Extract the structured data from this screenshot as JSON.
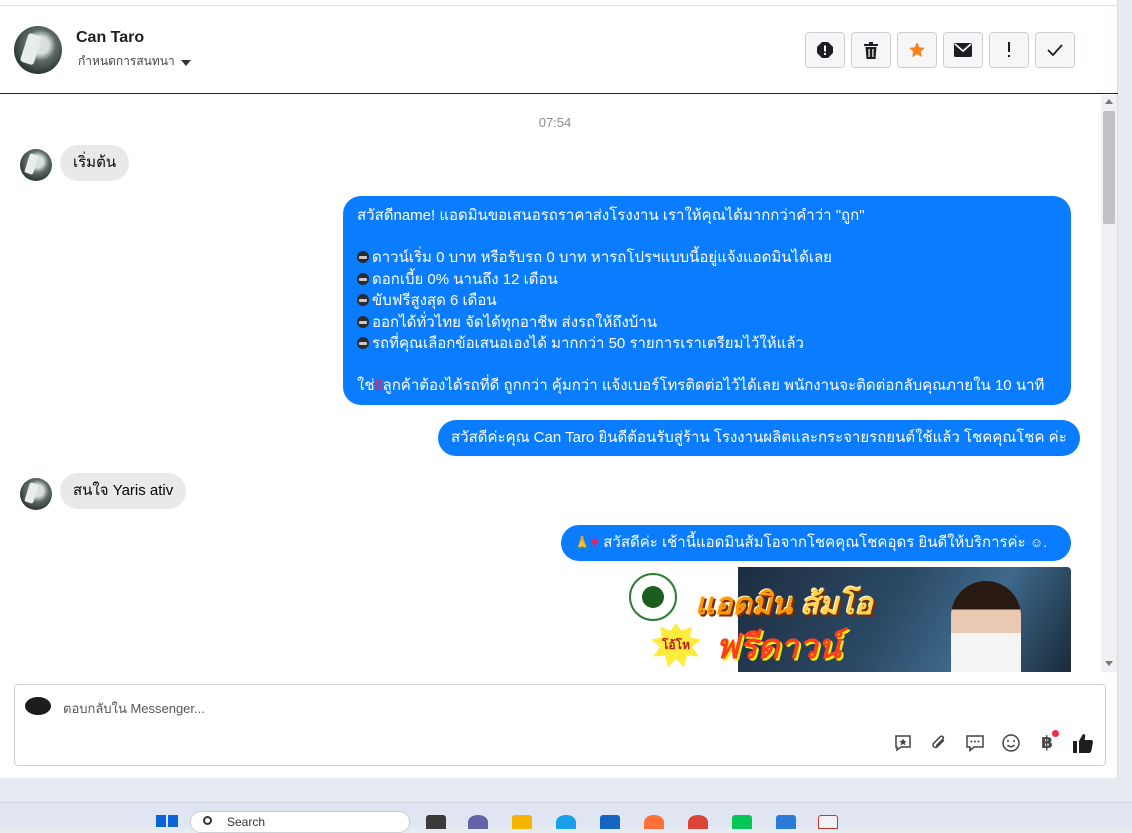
{
  "header": {
    "contact_name": "Can Taro",
    "assign_label": "กำหนดการสนทนา",
    "actions": [
      "spam-icon",
      "trash-icon",
      "star-icon",
      "envelope-icon",
      "exclamation-icon",
      "check-icon"
    ],
    "star_color": "#f5821f"
  },
  "chat": {
    "timestamp": "07:54",
    "messages": [
      {
        "dir": "in",
        "text": "เริ่มต้น"
      },
      {
        "dir": "out",
        "lines": [
          "สวัสดีname! แอดมินขอเสนอรถราคาส่งโรงงาน เราให้คุณได้มากกว่าคำว่า \"ถูก\"",
          "",
          "ดาวน์เริ่ม 0 บาท หรือรับรถ 0 บาท หารถโปรฯแบบนี้อยู่แจ้งแอดมินได้เลย",
          "ดอกเบี้ย 0% นานถึง 12 เดือน",
          "ขับฟรีสูงสุด 6 เดือน",
          "ออกได้ทั่วไทย จัดได้ทุกอาชีพ ส่งรถให้ถึงบ้าน",
          "รถที่คุณเลือกข้อเสนอเองได้ มากกว่า 50 รายการเราเตรียมไว้ให้แล้ว",
          "",
          "ใช่",
          "ลูกค้าต้องได้รถที่ดี ถูกกว่า คุ้มกว่า แจ้งเบอร์โทรติดต่อไว้ได้เลย พนักงานจะติดต่อกลับคุณภายใน 10 นาที"
        ]
      },
      {
        "dir": "out",
        "text": "สวัสดีค่ะคุณ Can Taro ยินดีต้อนรับสู่ร้าน โรงงานผลิตและกระจายรถยนต์ใช้แล้ว โชคคุณโชค ค่ะ"
      },
      {
        "dir": "in",
        "text": "สนใจ Yaris ativ"
      },
      {
        "dir": "out",
        "text": "สวัสดีค่ะ เช้านี้แอดมินส้มโอจากโชคคุณโชคอุดร ยินดีให้บริการค่ะ"
      },
      {
        "dir": "out",
        "type": "image",
        "title": "แอดมิน",
        "title2": "ส้มโอ",
        "badge": "โอ้โห",
        "subtitle": "ฟรีดาวน์"
      }
    ],
    "bubble_out_color": "#0a7cff",
    "bubble_in_color": "#e9e9eb"
  },
  "composer": {
    "placeholder": "ตอบกลับใน Messenger...",
    "tools": [
      "saved-reply-icon",
      "attachment-icon",
      "comment-icon",
      "emoji-icon",
      "baht-icon",
      "like-icon"
    ],
    "baht_symbol": "฿"
  },
  "taskbar": {
    "search_placeholder": "Search"
  }
}
